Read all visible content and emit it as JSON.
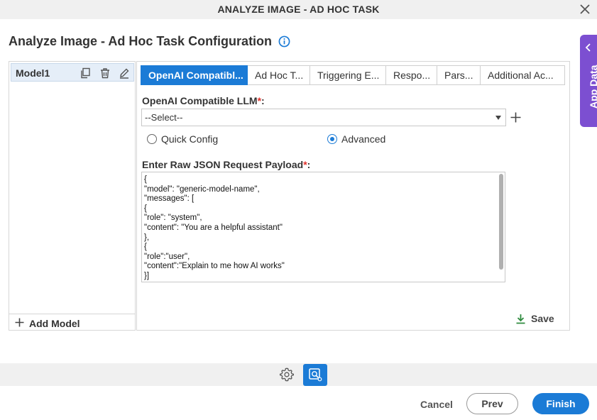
{
  "window": {
    "title": "ANALYZE IMAGE - AD HOC TASK"
  },
  "page": {
    "title": "Analyze Image - Ad Hoc Task Configuration"
  },
  "side_tab": {
    "label": "App Data"
  },
  "models": {
    "items": [
      {
        "name": "Model1"
      }
    ],
    "add_label": "Add Model"
  },
  "tabs": [
    {
      "label": "OpenAI Compatibl...",
      "active": true
    },
    {
      "label": "Ad Hoc T...",
      "active": false
    },
    {
      "label": "Triggering E...",
      "active": false
    },
    {
      "label": "Respo...",
      "active": false
    },
    {
      "label": "Pars...",
      "active": false
    },
    {
      "label": "Additional Ac...",
      "active": false
    }
  ],
  "form": {
    "llm_label": "OpenAI Compatible LLM",
    "llm_required": "*",
    "llm_colon": ":",
    "llm_select_value": "--Select--",
    "radio_quick": "Quick Config",
    "radio_advanced": "Advanced",
    "selected_mode": "Advanced",
    "payload_label": "Enter Raw JSON Request Payload",
    "payload_required": "*",
    "payload_colon": ":",
    "payload_lines": [
      "{",
      "\"model\": \"generic-model-name\",",
      "\"messages\": [",
      "{",
      "\"role\": \"system\",",
      "\"content\": \"You are a helpful assistant\"",
      "},",
      "{",
      "\"role\":\"user\",",
      "\"content\":\"Explain to me how AI works\"",
      "}]"
    ],
    "save_label": "Save"
  },
  "footer": {
    "cancel_label": "Cancel",
    "prev_label": "Prev",
    "finish_label": "Finish"
  },
  "colors": {
    "accent": "#1b7bd6",
    "side_tab": "#7c4fd1",
    "required": "#e0312b",
    "save_icon": "#2e8b3e"
  }
}
